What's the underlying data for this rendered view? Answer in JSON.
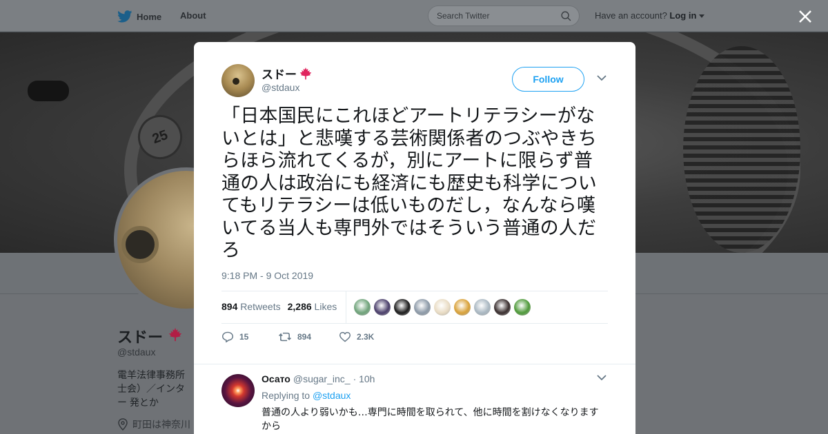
{
  "topbar": {
    "home_label": "Home",
    "about_label": "About",
    "search_placeholder": "Search Twitter",
    "account_prompt": "Have an account?",
    "login_label": "Log in"
  },
  "background_profile": {
    "banner_number": "25",
    "name": "スドー",
    "handle": "@stdaux",
    "bio": "電羊法律事務所 士会）／インター 発とか",
    "location": "町田は神奈川"
  },
  "tweet": {
    "author_name": "スドー",
    "author_handle": "@stdaux",
    "follow_label": "Follow",
    "text": "「日本国民にこれほどアートリテラシーがないとは」と悲嘆する芸術関係者のつぶやきちらほら流れてくるが，別にアートに限らず普通の人は政治にも経済にも歴史も科学についてもリテラシーは低いものだし，なんなら嘆いてる当人も専門外ではそういう普通の人だろ",
    "timestamp": "9:18 PM - 9 Oct 2019",
    "retweets_count": "894",
    "retweets_label": "Retweets",
    "likes_count": "2,286",
    "likes_label": "Likes",
    "actions": {
      "replies": "15",
      "retweets": "894",
      "likes": "2.3K"
    },
    "liker_colors": [
      "#6fa37a",
      "#4b3f6b",
      "#1d1d1d",
      "#8d9aa8",
      "#e9dcc4",
      "#d9a23a",
      "#aab8c2",
      "#3a2f2f",
      "#4f9a3a"
    ]
  },
  "reply": {
    "author_name": "Осато",
    "author_handle": "@sugar_inc_",
    "time": "· 10h",
    "replying_prefix": "Replying to",
    "replying_handle": "@stdaux",
    "text": "普通の人より弱いかも…専門に時間を取られて、他に時間を割けなくなりますから"
  },
  "colors": {
    "accent": "#1da1f2",
    "maple": "#e0245e",
    "muted": "#657786"
  }
}
